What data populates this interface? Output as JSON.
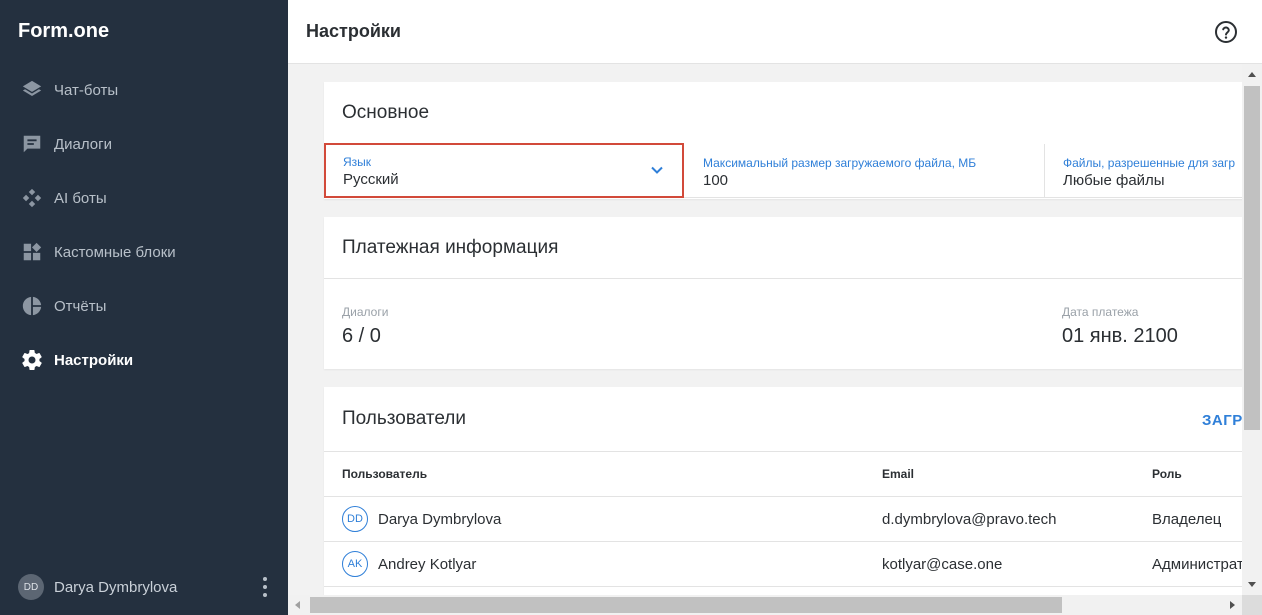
{
  "app": {
    "logo": "Form.one"
  },
  "sidebar": {
    "items": [
      {
        "label": "Чат-боты",
        "icon": "layers-icon"
      },
      {
        "label": "Диалоги",
        "icon": "chat-icon"
      },
      {
        "label": "AI боты",
        "icon": "ai-diamond-icon"
      },
      {
        "label": "Кастомные блоки",
        "icon": "blocks-icon"
      },
      {
        "label": "Отчёты",
        "icon": "pie-chart-icon"
      },
      {
        "label": "Настройки",
        "icon": "gear-icon",
        "active": true
      }
    ],
    "user": {
      "initials": "DD",
      "name": "Darya Dymbrylova"
    }
  },
  "header": {
    "title": "Настройки",
    "help_icon": "help-icon"
  },
  "general": {
    "title": "Основное",
    "language": {
      "label": "Язык",
      "value": "Русский"
    },
    "max_size": {
      "label": "Максимальный размер загружаемого файла, МБ",
      "value": "100"
    },
    "allowed_files": {
      "label": "Файлы, разрешенные для загр",
      "value": "Любые файлы"
    }
  },
  "billing": {
    "title": "Платежная информация",
    "dialogs": {
      "label": "Диалоги",
      "value": "6 / 0"
    },
    "payment_date": {
      "label": "Дата платежа",
      "value": "01 янв. 2100"
    }
  },
  "users": {
    "title": "Пользователи",
    "action": "ЗАГР",
    "columns": {
      "user": "Пользователь",
      "email": "Email",
      "role": "Роль"
    },
    "rows": [
      {
        "initials": "DD",
        "name": "Darya Dymbrylova",
        "email": "d.dymbrylova@pravo.tech",
        "role": "Владелец"
      },
      {
        "initials": "AK",
        "name": "Andrey Kotlyar",
        "email": "kotlyar@case.one",
        "role": "Администрат"
      }
    ]
  },
  "colors": {
    "sidebar_bg": "#24303f",
    "accent": "#2f7fd8",
    "focus_border": "#d24a3a",
    "content_bg": "#f2f2f2"
  }
}
